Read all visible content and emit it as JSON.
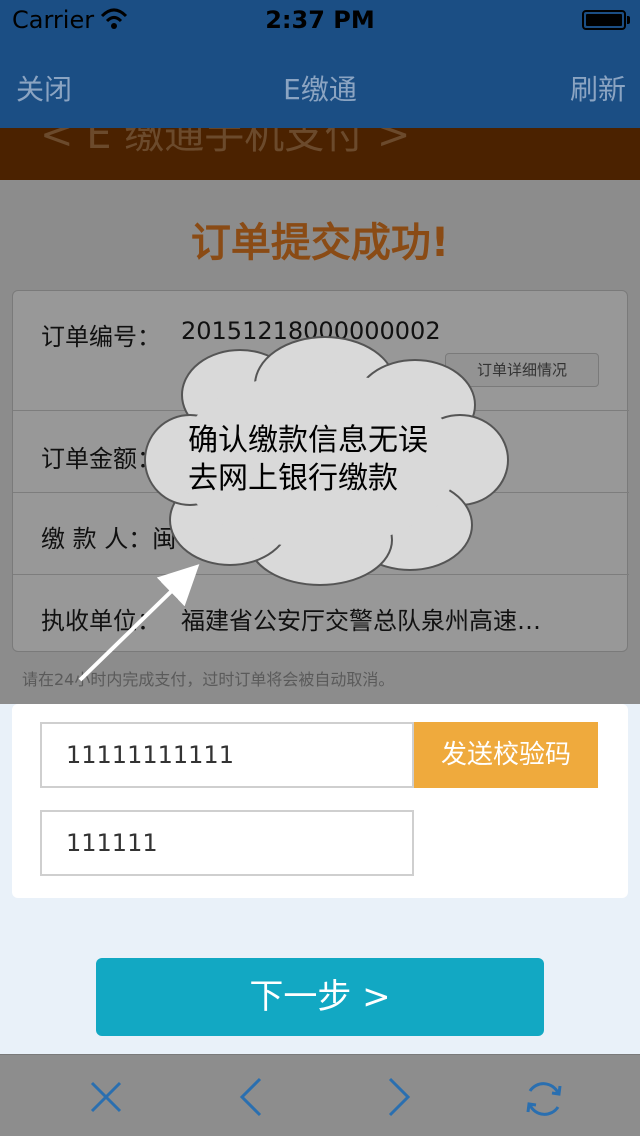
{
  "status_bar": {
    "carrier": "Carrier",
    "time": "2:37 PM"
  },
  "nav": {
    "left": "关闭",
    "title": "E缴通",
    "right": "刷新"
  },
  "banner": {
    "text": "< E 缴通手机支付 >"
  },
  "page": {
    "success_title": "订单提交成功!",
    "order_number_label": "订单编号：",
    "order_number_value": "20151218000000002",
    "detail_button": "订单详细情况",
    "amount_label": "订单金额：",
    "payer_label": "缴 款 人：闽",
    "collector_label": "执收单位：",
    "collector_value": "福建省公安厅交警总队泉州高速…",
    "notice": "请在24小时内完成支付，过时订单将会被自动取消。"
  },
  "form": {
    "phone_value": "11111111111",
    "send_code_button": "发送校验码",
    "code_value": "111111",
    "next_button": "下一步  >"
  },
  "annotation": {
    "line1": "确认缴款信息无误",
    "line2": "去网上银行缴款"
  },
  "toolbar": {
    "icons": [
      "close-icon",
      "back-icon",
      "forward-icon",
      "refresh-icon"
    ]
  },
  "colors": {
    "nav_bg": "#1b4e84",
    "accent_orange": "#efaa3d",
    "primary_button": "#12a8c3"
  }
}
